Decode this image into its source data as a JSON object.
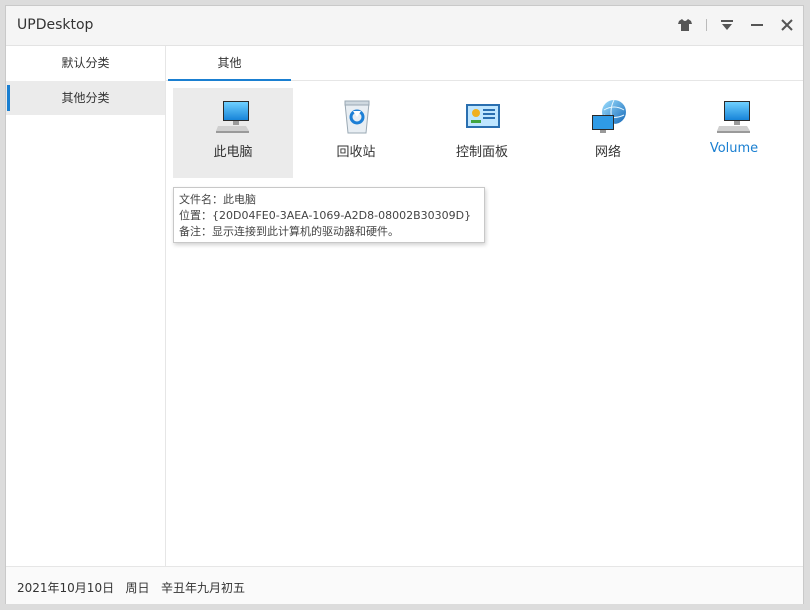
{
  "window": {
    "title": "UPDesktop",
    "controls": [
      "skin-icon",
      "menu-icon",
      "minimize-icon",
      "close-icon"
    ]
  },
  "sidebar": {
    "items": [
      {
        "label": "默认分类",
        "active": false
      },
      {
        "label": "其他分类",
        "active": true
      }
    ]
  },
  "tabs": [
    {
      "label": "其他",
      "active": true
    }
  ],
  "icons": [
    {
      "label": "此电脑",
      "icon": "computer-icon",
      "hovered": true
    },
    {
      "label": "回收站",
      "icon": "recycle-bin-icon",
      "hovered": false
    },
    {
      "label": "控制面板",
      "icon": "control-panel-icon",
      "hovered": false
    },
    {
      "label": "网络",
      "icon": "network-icon",
      "hovered": false
    },
    {
      "label": "Volume",
      "icon": "drive-icon",
      "hovered": false
    }
  ],
  "tooltip": {
    "name": "文件名：此电脑",
    "location": "位置：{20D04FE0-3AEA-1069-A2D8-08002B30309D}",
    "note": "备注：显示连接到此计算机的驱动器和硬件。"
  },
  "status": {
    "date_text": "2021年10月10日   周日   辛丑年九月初五"
  },
  "colors": {
    "accent": "#1a7fd1",
    "active_bg": "#ebebeb"
  }
}
